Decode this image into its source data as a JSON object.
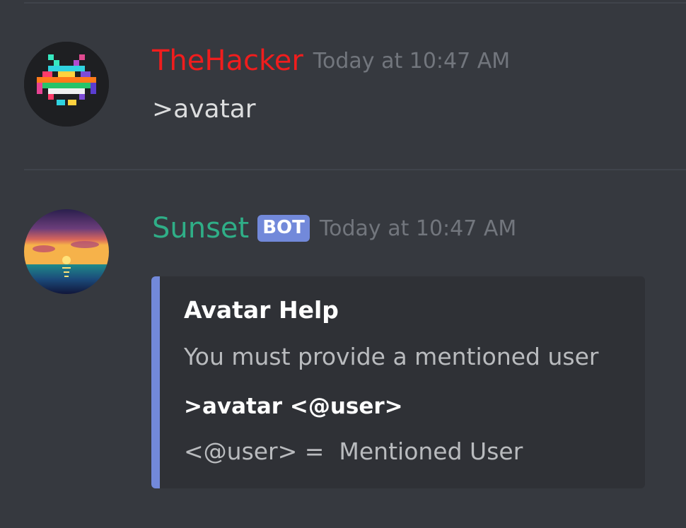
{
  "messages": [
    {
      "username": "TheHacker",
      "username_color": "#f01d1d",
      "timestamp": "Today at 10:47 AM",
      "content": ">avatar",
      "avatar_icon": "space-invader-rainbow"
    },
    {
      "username": "Sunset",
      "username_color": "#2fae87",
      "bot_tag": "BOT",
      "timestamp": "Today at 10:47 AM",
      "avatar_icon": "sunset-ocean",
      "embed": {
        "accent_color": "#7289da",
        "title": "Avatar Help",
        "description": "You must provide a mentioned user",
        "field_name": ">avatar <@user>",
        "field_value": "<@user> =  Mentioned User"
      }
    }
  ]
}
